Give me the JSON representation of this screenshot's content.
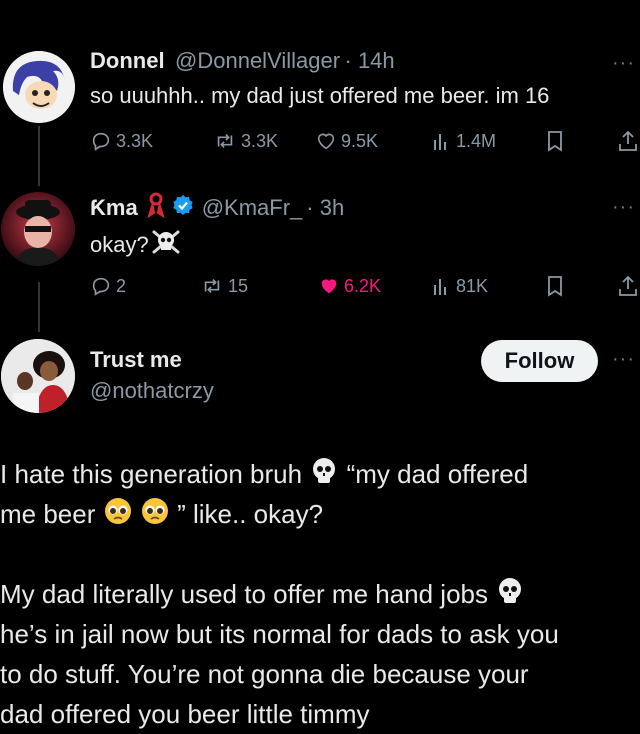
{
  "tweet1": {
    "name": "Donnel",
    "handle": "@DonnelVillager",
    "time": "· 14h",
    "text": "so uuuhhh.. my dad just offered me beer. im 16",
    "replies": "3.3K",
    "retweets": "3.3K",
    "likes": "9.5K",
    "views": "1.4M"
  },
  "tweet2": {
    "name": "Ƙma",
    "handle": "@KmaFr_",
    "time": "· 3h",
    "text": "okay?",
    "replies": "2",
    "retweets": "15",
    "likes": "6.2K",
    "views": "81K"
  },
  "tweet3": {
    "name": "Trust me",
    "handle": "@nothatcrzy",
    "follow_label": "Follow",
    "para1_line1_a": "I hate this generation bruh",
    "para1_line1_b": "“my dad offered",
    "para1_line2_a": "me beer",
    "para1_line2_b": "” like.. okay?",
    "para2_line1": "My dad literally used to offer me hand jobs",
    "para2_line2": "he’s in jail now but its normal for dads to ask you",
    "para2_line3": "to do stuff. You’re not gonna die because your",
    "para2_line4": "dad offered you beer little timmy"
  },
  "colors": {
    "background": "#000000",
    "primary_text": "#e7e9ea",
    "secondary_text": "#8b98a5",
    "like_active": "#f91880",
    "verified": "#1d9bf0"
  }
}
